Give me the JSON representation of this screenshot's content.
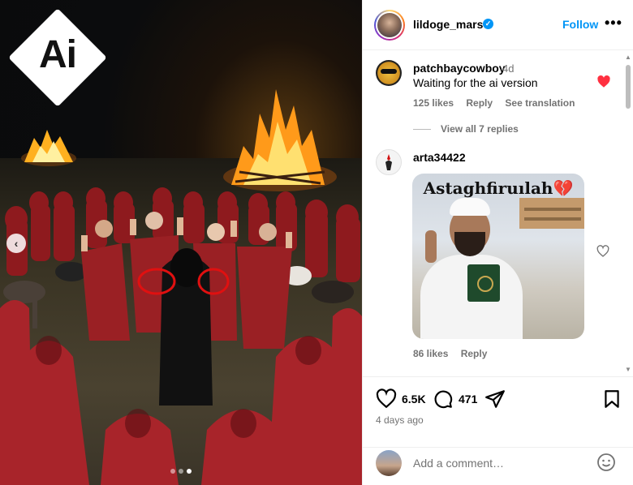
{
  "post": {
    "badge_text": "Ai",
    "carousel_dots": 3,
    "carousel_active": 3
  },
  "header": {
    "username": "lildoge_mars",
    "follow_label": "Follow",
    "more_label": "•••"
  },
  "comments": [
    {
      "username": "patchbaycowboy",
      "time": "4d",
      "text": "Waiting for the ai version",
      "likes": "125 likes",
      "reply_label": "Reply",
      "translate_label": "See translation",
      "liked": true,
      "view_replies": "View all 7 replies"
    },
    {
      "username": "arta34422",
      "gif_caption": "Astaghfiruılah",
      "gif_emoji": "💔",
      "likes": "86 likes",
      "reply_label": "Reply",
      "liked": false
    }
  ],
  "actions": {
    "likes_count": "6.5K",
    "comments_count": "471",
    "posted_ago": "4 days ago"
  },
  "comment_box": {
    "placeholder": "Add a comment…"
  },
  "colors": {
    "accent": "#0095f6",
    "like_red": "#ff3040",
    "muted": "#737373"
  }
}
